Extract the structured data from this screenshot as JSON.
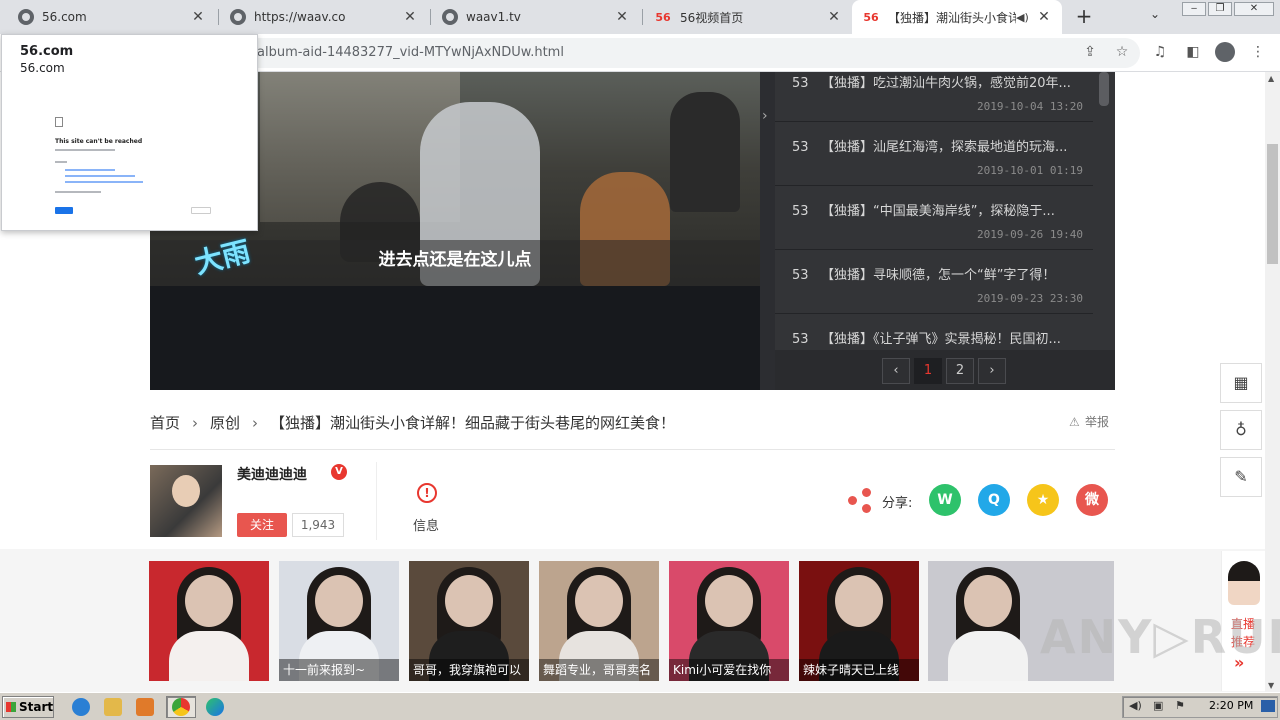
{
  "browser": {
    "tabs": [
      {
        "title": "56.com",
        "icon": "globe-icon"
      },
      {
        "title": "https://waav.co",
        "icon": "globe-icon"
      },
      {
        "title": "waav1.tv",
        "icon": "globe-icon"
      },
      {
        "title": "56视频首页",
        "icon": "56-logo-icon"
      },
      {
        "title": "【独播】潮汕街头小食详解",
        "icon": "56-logo-icon",
        "active": true
      }
    ],
    "brand_mark": "56",
    "url": "album-aid-14483277_vid-MTYwNjAxNDUw.html"
  },
  "popup": {
    "title": "56.com",
    "subtitle": "56.com",
    "preview_heading": "This site can't be reached"
  },
  "video": {
    "subtitle": "进去点还是在这儿点",
    "overlay_text": "大雨"
  },
  "playlist": {
    "items": [
      {
        "index": "53",
        "title": "【独播】吃过潮汕牛肉火锅，感觉前20年...",
        "date": "2019-10-04 13:20"
      },
      {
        "index": "53",
        "title": "【独播】汕尾红海湾，探索最地道的玩海...",
        "date": "2019-10-01 01:19"
      },
      {
        "index": "53",
        "title": "【独播】“中国最美海岸线”，探秘隐于...",
        "date": "2019-09-26 19:40"
      },
      {
        "index": "53",
        "title": "【独播】寻味顺德，怎一个“鲜”字了得！",
        "date": "2019-09-23 23:30"
      },
      {
        "index": "53",
        "title": "【独播】《让子弹飞》实景揭秘！民国初...",
        "date": ""
      }
    ],
    "pages": [
      "1",
      "2"
    ],
    "current_page": "1",
    "prev": "‹",
    "next": "›"
  },
  "breadcrumb": {
    "home": "首页",
    "category": "原创",
    "title": "【独播】潮汕街头小食详解！细品藏于街头巷尾的网红美食！"
  },
  "report_label": "举报",
  "uploader": {
    "name": "美迪迪迪迪",
    "badge": "V",
    "follow_label": "关注",
    "followers": "1,943"
  },
  "info_label": "信息",
  "share": {
    "label": "分享:",
    "channels": [
      {
        "name": "wechat",
        "color": "#2ec26b",
        "glyph": "W"
      },
      {
        "name": "qq",
        "color": "#22a8e8",
        "glyph": "Q"
      },
      {
        "name": "qzone",
        "color": "#f6c51a",
        "glyph": "★"
      },
      {
        "name": "weibo",
        "color": "#e8564f",
        "glyph": "微"
      }
    ]
  },
  "recommend": [
    {
      "caption": "",
      "bg": "#c8282e",
      "body": "#f4f0ee"
    },
    {
      "caption": "十一前来报到~",
      "bg": "#d9dde4",
      "body": "#eef0f3"
    },
    {
      "caption": "哥哥，我穿旗袍可以",
      "bg": "#5a4a3c",
      "body": "#1e1e1e"
    },
    {
      "caption": "舞蹈专业，哥哥卖名",
      "bg": "#bca48e",
      "body": "#e7e3df"
    },
    {
      "caption": "Kimi小可爱在找你",
      "bg": "#d94a6a",
      "body": "#2a2a2a"
    },
    {
      "caption": "辣妹子晴天已上线",
      "bg": "#7a1010",
      "body": "#1a1a1a"
    },
    {
      "caption": "",
      "bg": "#c9c9cf",
      "body": "#f2f2f2"
    }
  ],
  "live": {
    "line1": "直播",
    "line2": "推荐",
    "arrow": "»"
  },
  "floating_tools": [
    {
      "name": "qrcode-button",
      "glyph": "▦"
    },
    {
      "name": "idea-button",
      "glyph": "♁"
    },
    {
      "name": "edit-button",
      "glyph": "✎"
    }
  ],
  "taskbar": {
    "start": "Start",
    "clock": "2:20 PM"
  },
  "watermark": "ANY▷RUN"
}
